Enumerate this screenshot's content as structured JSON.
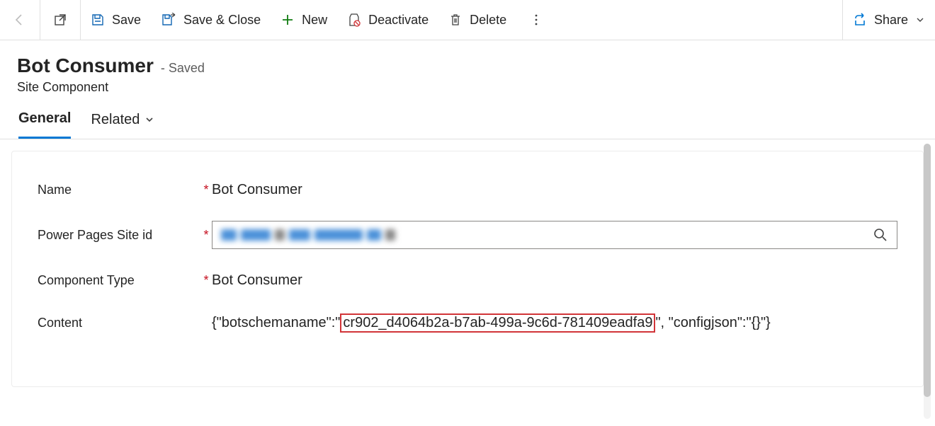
{
  "toolbar": {
    "save": "Save",
    "save_close": "Save & Close",
    "new": "New",
    "deactivate": "Deactivate",
    "delete": "Delete",
    "share": "Share"
  },
  "header": {
    "title": "Bot Consumer",
    "status": "- Saved",
    "subtitle": "Site Component"
  },
  "tabs": {
    "general": "General",
    "related": "Related"
  },
  "form": {
    "name_label": "Name",
    "name_value": "Bot Consumer",
    "siteid_label": "Power Pages Site id",
    "type_label": "Component Type",
    "type_value": "Bot Consumer",
    "content_label": "Content",
    "content_lead": "{\"botschemaname\":\"",
    "content_highlight": "cr902_d4064b2a-b7ab-499a-9c6d-781409eadfa9",
    "content_tail": "\", \"configjson\":\"{}\"}"
  }
}
